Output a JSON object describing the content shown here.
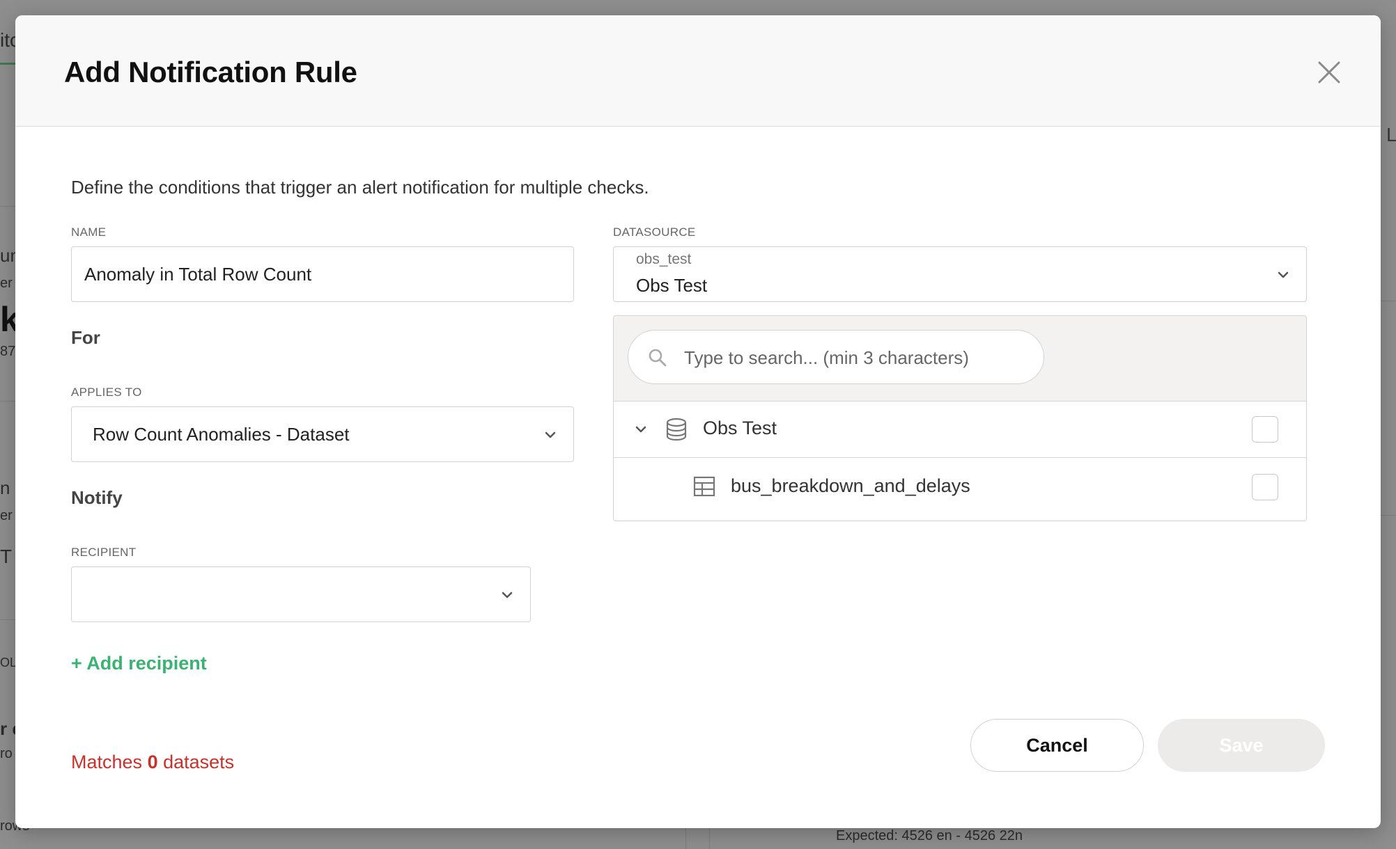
{
  "background": {
    "fragments": [
      "itc",
      "L",
      "un",
      "er",
      "k",
      "87",
      "n t",
      "er",
      "T",
      "OLU",
      "r c",
      "ro",
      "rows",
      "Expected: 4526 en - 4526 22n"
    ]
  },
  "modal": {
    "title": "Add Notification Rule",
    "description": "Define the conditions that trigger an alert notification for multiple checks.",
    "name_field": {
      "label": "NAME",
      "value": "Anomaly in Total Row Count"
    },
    "for_heading": "For",
    "applies_to": {
      "label": "APPLIES TO",
      "value": "Row Count Anomalies - Dataset"
    },
    "notify_heading": "Notify",
    "recipient": {
      "label": "RECIPIENT",
      "value": ""
    },
    "add_recipient": "+ Add recipient",
    "datasource": {
      "label": "DATASOURCE",
      "id": "obs_test",
      "value": "Obs Test"
    },
    "search": {
      "placeholder": "Type to search... (min 3 characters)"
    },
    "tree": {
      "root": "Obs Test",
      "child": "bus_breakdown_and_delays"
    },
    "matches": {
      "prefix": "Matches",
      "count": "0",
      "suffix": "datasets"
    },
    "buttons": {
      "cancel": "Cancel",
      "save": "Save"
    }
  },
  "colors": {
    "accent_green": "#3bb273",
    "error_red": "#c4342d",
    "disabled_bg": "#ecebe9"
  }
}
